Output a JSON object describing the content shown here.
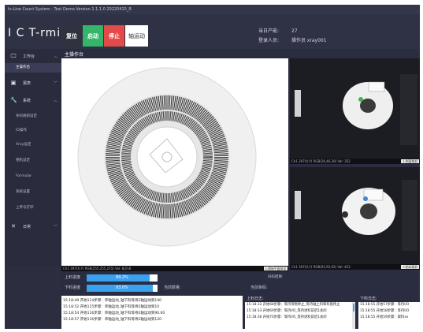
{
  "window": {
    "title": "In-Line Count System - Test Demo Version 1.1.1.0 20220415_R"
  },
  "header": {
    "logo": "I C T-rmi",
    "controls": {
      "reset": "复位",
      "start": "启动",
      "stop": "停止",
      "axis": "轴运动"
    },
    "stats": {
      "daily_output_label": "当日产能:",
      "daily_output_value": "27",
      "login_label": "登录人员:",
      "login_value": "操作员 xray001"
    }
  },
  "sidebar": {
    "sections": [
      {
        "label": "工作台",
        "icon": "monitor-icon"
      },
      {
        "label": "报表",
        "icon": "report-icon"
      },
      {
        "label": "系统",
        "icon": "wrench-icon"
      },
      {
        "label": "日常",
        "icon": "tools-icon"
      }
    ],
    "workbench_items": [
      "主操作台"
    ],
    "system_items": [
      "条码规则设定",
      "IO操作",
      "Xray设定",
      "相机设定",
      "Formular",
      "系统设置",
      "上传与打印"
    ]
  },
  "main": {
    "title": "主操作台",
    "main_view_status": "Ch1  397(X,Y)  RGB(255,255,255)  Val: 8/218",
    "main_view_tag": "1.原始平面测试",
    "cam1_status": "Ch1  397(X,Y)  RGB(26,46,28)  Val: 352",
    "cam1_tag": "2.侧面相机",
    "cam2_status": "Ch1  397(X,Y)  RGB(92,92,92)  Val: 453",
    "cam2_tag": "3.贴标相机"
  },
  "progress": {
    "feed_label": "上料进度",
    "feed_value": 89.2,
    "feed_text": "89.2%",
    "unload_label": "下料进度",
    "unload_value": 93.0,
    "unload_text": "93.0%"
  },
  "info": {
    "current_data": "当前数量:",
    "current_item": "当前条码:",
    "scan_result": "扫码结果:"
  },
  "logs": {
    "main": [
      "15:18:49 开始114步骤：单轴运动_轴下料等待2轴运动到140",
      "15:18:52 开始115步骤：单轴运动_轴下料等待2轴运动到10",
      "15:18:54 开始116步骤：单轴运动_轴下料等待2轴运动到90.00",
      "15:18:57 开始116步骤：单轴运动_轴下料等待2轴运动到120"
    ],
    "upload_title": "上料日志:",
    "upload": [
      "15:18:32 开始68步骤：等待等物停止_等待轴上料和料盘停止",
      "15:18:33 开始69步骤：等待I/O_等待进料前后1关闭",
      "15:18:36 开始70步骤：等待I/O_等待进料前后1关闭"
    ],
    "unload_title": "下料日志:",
    "unload": [
      "15:18:55 开始57步骤：等待I/O",
      "15:18:55 开始58步骤：等待I/O",
      "15:18:55 开始59步骤：取料xx"
    ]
  },
  "colors": {
    "background": "#2c2e40",
    "accent": "#3aa0f0",
    "start": "#35b56a",
    "stop": "#e34a4a"
  }
}
